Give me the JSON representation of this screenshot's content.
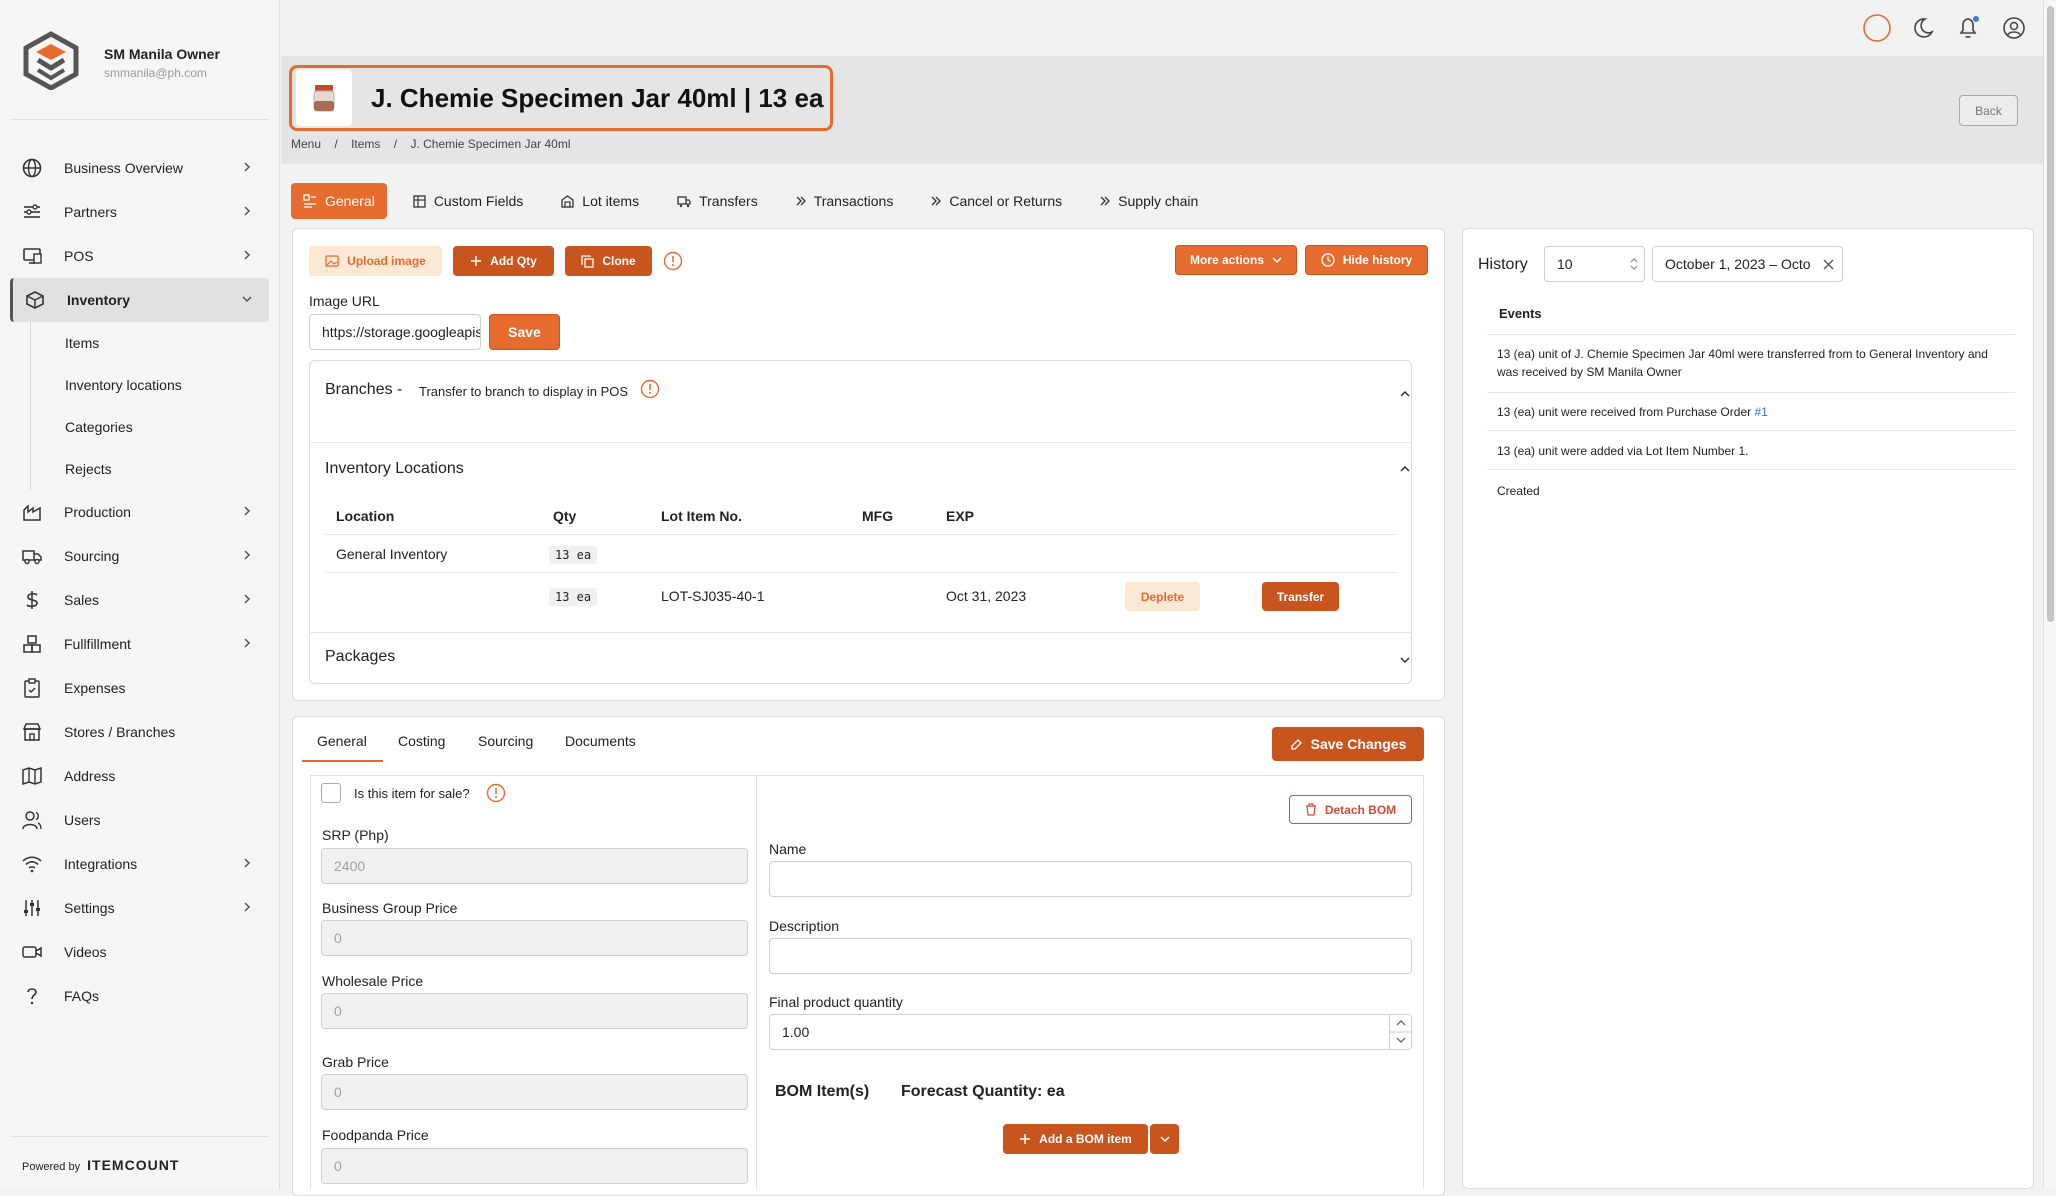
{
  "sidebar": {
    "owner": "SM Manila Owner",
    "email": "smmanila@ph.com",
    "items": [
      {
        "label": "Business Overview",
        "icon": "globe-icon",
        "chevron": true
      },
      {
        "label": "Partners",
        "icon": "partners-icon",
        "chevron": true
      },
      {
        "label": "POS",
        "icon": "pos-icon",
        "chevron": true
      },
      {
        "label": "Inventory",
        "icon": "box-icon",
        "chevron": true
      }
    ],
    "inventory_sub": [
      "Items",
      "Inventory locations",
      "Categories",
      "Rejects"
    ],
    "items_after": [
      {
        "label": "Production",
        "icon": "factory-icon",
        "chevron": true
      },
      {
        "label": "Sourcing",
        "icon": "truck-icon",
        "chevron": true
      },
      {
        "label": "Sales",
        "icon": "dollar-icon",
        "chevron": true
      },
      {
        "label": "Fullfillment",
        "icon": "boxes-icon",
        "chevron": true
      },
      {
        "label": "Expenses",
        "icon": "clipboard-icon",
        "chevron": false
      },
      {
        "label": "Stores / Branches",
        "icon": "store-icon",
        "chevron": false
      },
      {
        "label": "Address",
        "icon": "map-icon",
        "chevron": false
      },
      {
        "label": "Users",
        "icon": "users-icon",
        "chevron": false
      },
      {
        "label": "Integrations",
        "icon": "wifi-icon",
        "chevron": true
      },
      {
        "label": "Settings",
        "icon": "sliders-icon",
        "chevron": true
      },
      {
        "label": "Videos",
        "icon": "video-icon",
        "chevron": false
      },
      {
        "label": "FAQs",
        "icon": "question-icon",
        "chevron": false
      }
    ],
    "powered_by": "Powered by",
    "powered_brand": "ITEMCOUNT"
  },
  "header": {
    "title": "J. Chemie Specimen Jar 40ml | 13 ea",
    "back_label": "Back",
    "breadcrumb": [
      "Menu",
      "/",
      "Items",
      "/",
      "J. Chemie Specimen Jar 40ml"
    ]
  },
  "tabs": [
    {
      "label": "General",
      "icon": "general-icon"
    },
    {
      "label": "Custom Fields",
      "icon": "table-icon"
    },
    {
      "label": "Lot items",
      "icon": "lot-icon"
    },
    {
      "label": "Transfers",
      "icon": "transfer-icon"
    },
    {
      "label": "Transactions",
      "icon": "double-chevron-icon"
    },
    {
      "label": "Cancel or Returns",
      "icon": "double-chevron-icon"
    },
    {
      "label": "Supply chain",
      "icon": "double-chevron-icon"
    }
  ],
  "actions": {
    "upload_image": "Upload image",
    "add_qty": "Add Qty",
    "clone": "Clone",
    "more_actions": "More actions",
    "hide_history": "Hide history",
    "image_url_label": "Image URL",
    "image_url_value": "https://storage.googleapis.com",
    "save": "Save"
  },
  "branches": {
    "title": "Branches -",
    "subtitle": "Transfer to branch to display in POS"
  },
  "inventory_locations": {
    "title": "Inventory Locations",
    "columns": [
      "Location",
      "Qty",
      "Lot Item No.",
      "MFG",
      "EXP"
    ],
    "row1": {
      "location": "General Inventory",
      "qty": "13 ea"
    },
    "row2": {
      "qty": "13 ea",
      "lot": "LOT-SJ035-40-1",
      "exp": "Oct 31, 2023",
      "deplete": "Deplete",
      "transfer": "Transfer"
    }
  },
  "packages": {
    "title": "Packages"
  },
  "history": {
    "title": "History",
    "page_size": "10",
    "date_range": "October 1, 2023 – Octo",
    "events_title": "Events",
    "events": [
      {
        "text": "13 (ea) unit of J. Chemie Specimen Jar 40ml were transferred from to General Inventory and was received by SM Manila Owner"
      },
      {
        "text": "13 (ea) unit were received from Purchase Order ",
        "link": "#1"
      },
      {
        "text": "13 (ea) unit were added via Lot Item Number 1."
      },
      {
        "text": "Created"
      }
    ]
  },
  "details": {
    "subtabs": [
      "General",
      "Costing",
      "Sourcing",
      "Documents"
    ],
    "save_changes": "Save Changes",
    "for_sale_label": "Is this item for sale?",
    "prices": [
      {
        "label": "SRP (Php)",
        "placeholder": "2400"
      },
      {
        "label": "Business Group Price",
        "placeholder": "0"
      },
      {
        "label": "Wholesale Price",
        "placeholder": "0"
      },
      {
        "label": "Grab Price",
        "placeholder": "0"
      },
      {
        "label": "Foodpanda Price",
        "placeholder": "0"
      }
    ],
    "detach_bom": "Detach BOM",
    "name_label": "Name",
    "description_label": "Description",
    "final_qty_label": "Final product quantity",
    "final_qty_value": "1.00",
    "bom_items": "BOM Item(s)",
    "forecast": "Forecast Quantity: ea",
    "add_bom": "Add a BOM item"
  },
  "colors": {
    "accent": "#e56b2f",
    "accent_dark": "#c8541e",
    "link": "#2f6fd0"
  }
}
